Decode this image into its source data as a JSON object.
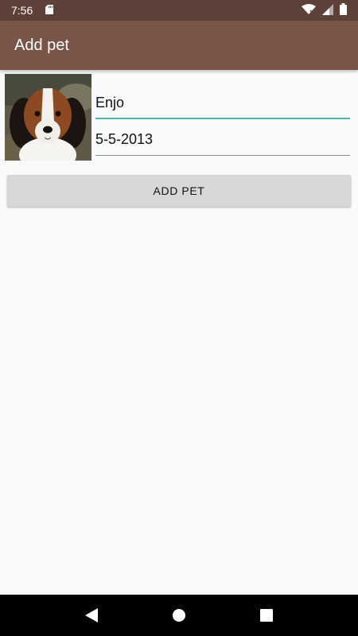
{
  "status_bar": {
    "time": "7:56",
    "icons": [
      "sd-card-icon",
      "wifi-icon",
      "cell-signal-icon",
      "battery-icon"
    ]
  },
  "app_bar": {
    "title": "Add pet"
  },
  "form": {
    "photo": {
      "subject": "dog-photo"
    },
    "name_value": "Enjo",
    "date_value": "5-5-2013",
    "add_button_label": "ADD PET"
  },
  "nav_bar": {
    "buttons": [
      "back-icon",
      "home-icon",
      "recents-icon"
    ]
  },
  "colors": {
    "status_bar": "#5d4037",
    "app_bar": "#795548",
    "accent": "#4db6ac",
    "background": "#fafafa",
    "button": "#d6d7d7"
  }
}
